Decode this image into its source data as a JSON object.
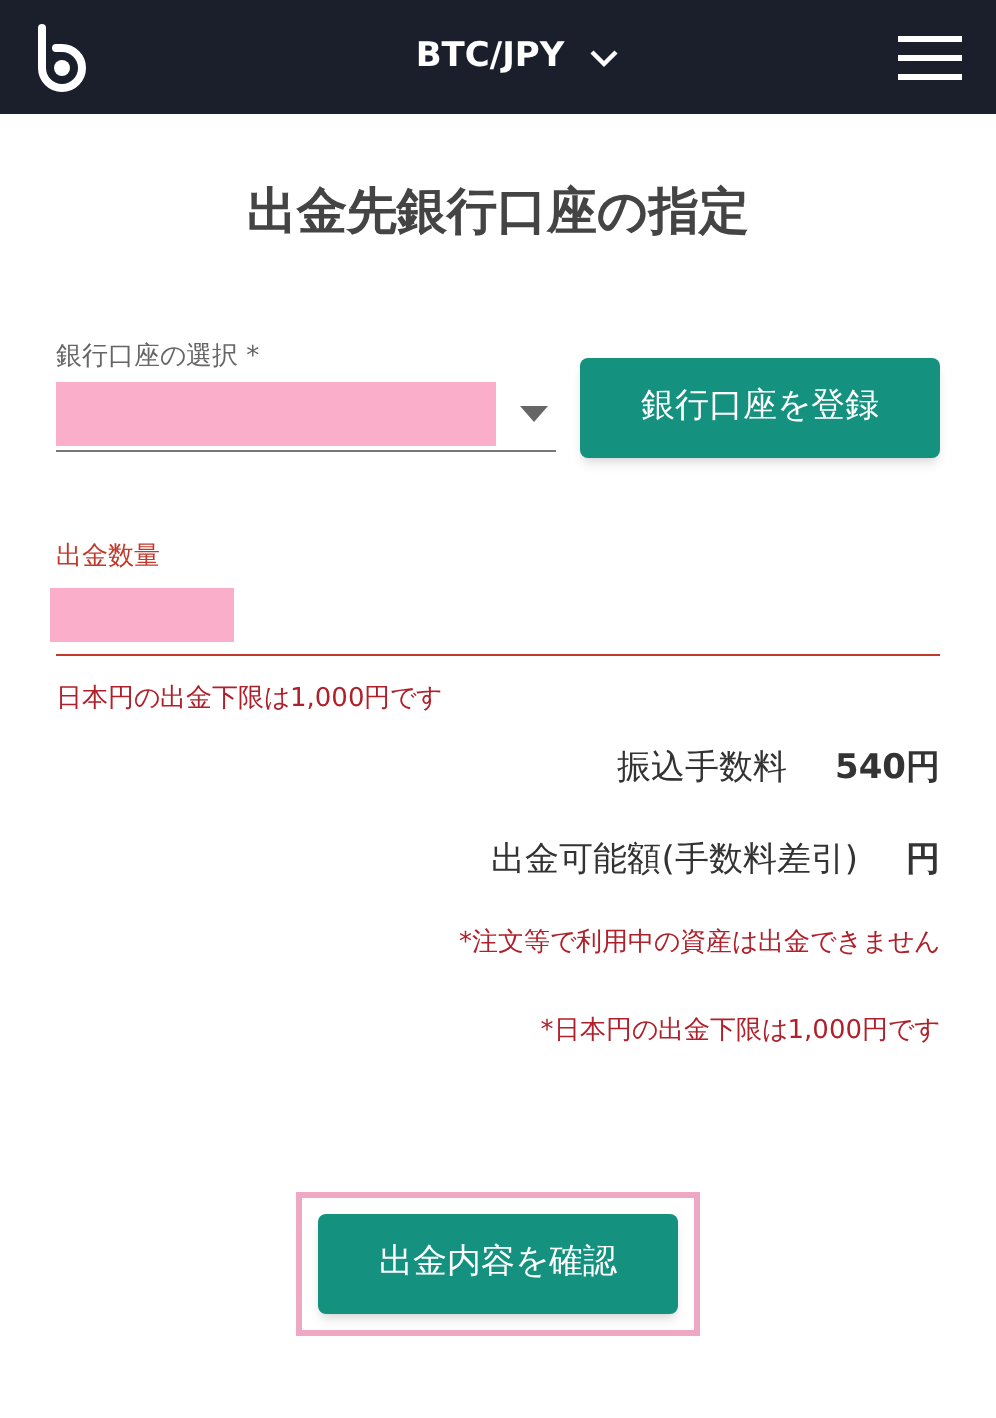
{
  "header": {
    "pair": "BTC/JPY"
  },
  "title": "出金先銀行口座の指定",
  "bank_select": {
    "label": "銀行口座の選択 *",
    "register_button": "銀行口座を登録"
  },
  "amount": {
    "label": "出金数量",
    "error": "日本円の出金下限は1,000円です"
  },
  "summary": [
    {
      "label": "振込手数料",
      "value": "540円"
    },
    {
      "label": "出金可能額(手数料差引)",
      "value": "円"
    }
  ],
  "notes": [
    "*注文等で利用中の資産は出金できません",
    "*日本円の出金下限は1,000円です"
  ],
  "confirm_button": "出金内容を確認"
}
